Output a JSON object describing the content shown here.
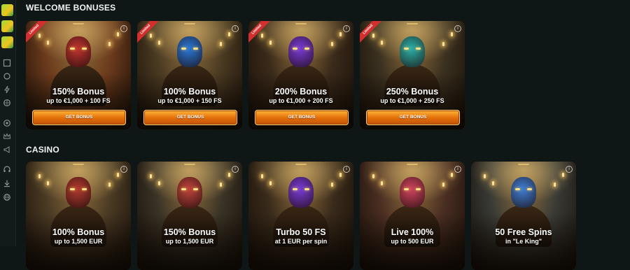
{
  "sidebar": {
    "icons": [
      "gift-icon",
      "gift-icon",
      "gift-icon",
      "grid-icon",
      "circle-icon",
      "bolt-icon",
      "ball-icon",
      "chip-icon",
      "crown-icon",
      "megaphone-icon",
      "headset-icon",
      "download-icon",
      "globe-icon"
    ]
  },
  "sections": {
    "welcome_title": "WELCOME BONUSES",
    "casino_title": "CASINO"
  },
  "welcome_cards": [
    {
      "title": "150% Bonus",
      "subtitle": "up to €1,000 + 100 FS",
      "button": "GET BONUS",
      "badge": "Limited",
      "theme": "#6b3a1c",
      "skin": "#c2342e"
    },
    {
      "title": "100% Bonus",
      "subtitle": "up to €1,000 + 150 FS",
      "button": "GET BONUS",
      "badge": "Limited",
      "theme": "#4a3a22",
      "skin": "#2a78d8"
    },
    {
      "title": "200% Bonus",
      "subtitle": "up to €1,000 + 200 FS",
      "button": "GET BONUS",
      "badge": "Limited",
      "theme": "#3a2a1a",
      "skin": "#7a3bd8"
    },
    {
      "title": "250% Bonus",
      "subtitle": "up to €1,000 + 250 FS",
      "button": "GET BONUS",
      "badge": "Limited",
      "theme": "#3b3120",
      "skin": "#2bb0a8"
    }
  ],
  "casino_cards": [
    {
      "title": "100% Bonus",
      "subtitle": "up to 1,500 EUR",
      "theme": "#4a3a24",
      "skin": "#b33a2e"
    },
    {
      "title": "150% Bonus",
      "subtitle": "up to 1,500 EUR",
      "theme": "#3a3326",
      "skin": "#c0443c"
    },
    {
      "title": "Turbo 50 FS",
      "subtitle": "at 1 EUR per spin",
      "theme": "#3a2b1b",
      "skin": "#7a3bd8"
    },
    {
      "title": "Live 100%",
      "subtitle": "up to 500 EUR",
      "theme": "#4a2e22",
      "skin": "#d0455e"
    },
    {
      "title": "50 Free Spins",
      "subtitle": "in \"Le King\"",
      "theme": "#3a3b36",
      "skin": "#3e7fd6"
    }
  ]
}
